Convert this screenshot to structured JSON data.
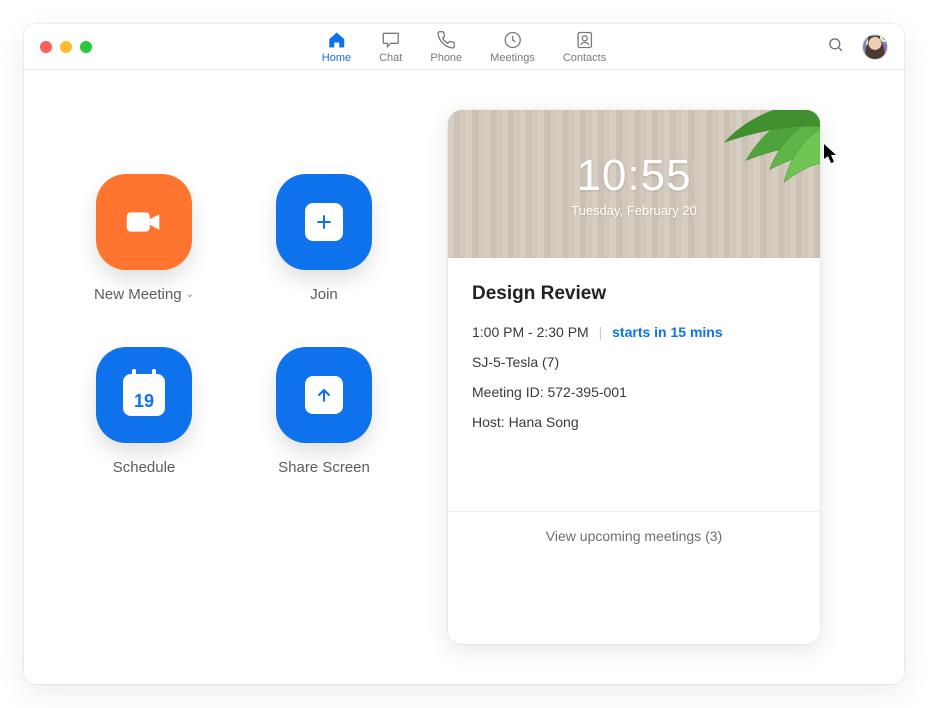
{
  "tabs": {
    "home": "Home",
    "chat": "Chat",
    "phone": "Phone",
    "meetings": "Meetings",
    "contacts": "Contacts"
  },
  "actions": {
    "new_meeting": "New Meeting",
    "join": "Join",
    "schedule": "Schedule",
    "share_screen": "Share Screen",
    "schedule_day": "19"
  },
  "clock": {
    "time": "10:55",
    "date": "Tuesday, February 20"
  },
  "meeting": {
    "title": "Design Review",
    "time_range": "1:00 PM - 2:30 PM",
    "starts_in": "starts in 15 mins",
    "room": "SJ-5-Tesla (7)",
    "id_label": "Meeting ID: 572-395-001",
    "host": "Host: Hana Song"
  },
  "footer": {
    "upcoming": "View upcoming meetings (3)"
  }
}
